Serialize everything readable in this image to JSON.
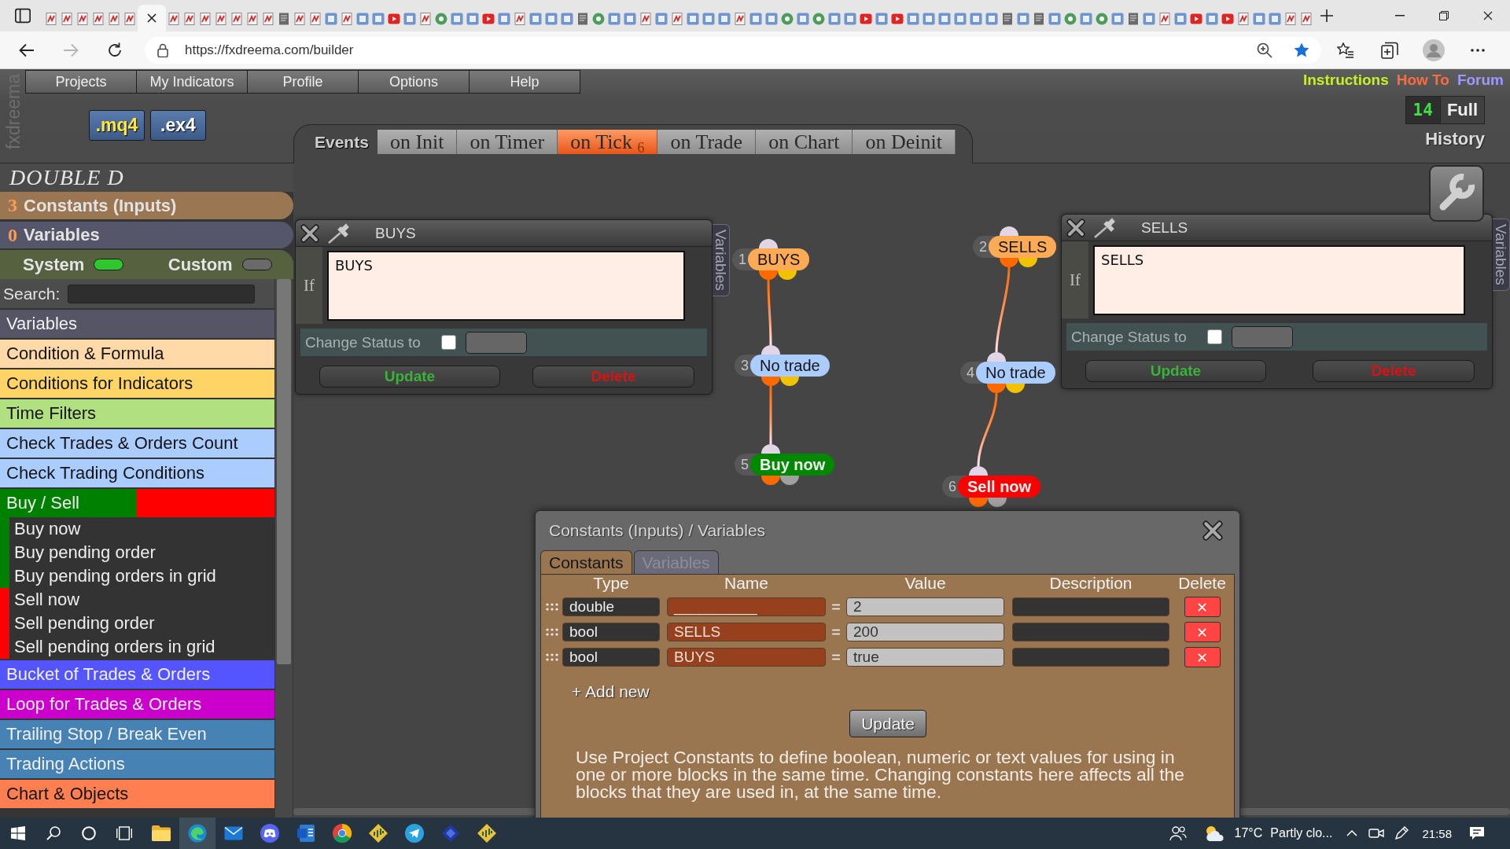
{
  "browser": {
    "tabs": [
      {
        "selected": false
      },
      {
        "selected": false
      },
      {
        "selected": false
      },
      {
        "selected": false
      },
      {
        "selected": false
      },
      {
        "selected": false
      },
      {
        "selected": true
      },
      {
        "selected": false
      },
      {
        "selected": false
      },
      {
        "selected": false
      },
      {
        "selected": false
      },
      {
        "selected": false
      },
      {
        "selected": false
      },
      {
        "selected": false
      },
      {
        "selected": false
      },
      {
        "selected": false
      },
      {
        "selected": false
      },
      {
        "selected": false
      },
      {
        "selected": false
      },
      {
        "selected": false
      },
      {
        "selected": false
      },
      {
        "selected": false
      },
      {
        "selected": false
      },
      {
        "selected": false
      },
      {
        "selected": false
      },
      {
        "selected": false
      },
      {
        "selected": false
      },
      {
        "selected": false
      },
      {
        "selected": false
      },
      {
        "selected": false
      },
      {
        "selected": false
      },
      {
        "selected": false
      },
      {
        "selected": false
      },
      {
        "selected": false
      },
      {
        "selected": false
      },
      {
        "selected": false
      },
      {
        "selected": false
      },
      {
        "selected": false
      },
      {
        "selected": false
      },
      {
        "selected": false
      },
      {
        "selected": false
      },
      {
        "selected": false
      },
      {
        "selected": false
      },
      {
        "selected": false
      },
      {
        "selected": false
      },
      {
        "selected": false
      },
      {
        "selected": false
      },
      {
        "selected": false
      },
      {
        "selected": false
      },
      {
        "selected": false
      },
      {
        "selected": false
      },
      {
        "selected": false
      },
      {
        "selected": false
      },
      {
        "selected": false
      },
      {
        "selected": false
      },
      {
        "selected": false
      },
      {
        "selected": false
      },
      {
        "selected": false
      },
      {
        "selected": false
      },
      {
        "selected": false
      },
      {
        "selected": false
      },
      {
        "selected": false
      },
      {
        "selected": false
      },
      {
        "selected": false
      },
      {
        "selected": false
      },
      {
        "selected": false
      },
      {
        "selected": false
      },
      {
        "selected": false
      },
      {
        "selected": false
      },
      {
        "selected": false
      },
      {
        "selected": false
      },
      {
        "selected": false
      },
      {
        "selected": false
      },
      {
        "selected": false
      },
      {
        "selected": false
      },
      {
        "selected": false
      },
      {
        "selected": false
      },
      {
        "selected": false
      },
      {
        "selected": false
      },
      {
        "selected": false
      }
    ],
    "url": "https://fxdreema.com/builder"
  },
  "header": {
    "logo": "fxdreema",
    "menu": [
      "Projects",
      "My Indicators",
      "Profile",
      "Options",
      "Help"
    ],
    "links": [
      {
        "label": "Instructions",
        "color": "#c6ef2a"
      },
      {
        "label": "How To",
        "color": "#ff6b3f"
      },
      {
        "label": "Forum",
        "color": "#9d98ff"
      }
    ],
    "exports": [
      {
        "label": ".mq4",
        "kind": "source"
      },
      {
        "label": ".ex4",
        "kind": "compiled"
      }
    ],
    "history": {
      "count": "14",
      "mode": "Full",
      "label": "History"
    }
  },
  "events": {
    "label": "Events",
    "tabs": [
      {
        "label": "on Init",
        "selected": false
      },
      {
        "label": "on Timer",
        "selected": false
      },
      {
        "label": "on Tick",
        "count": "6",
        "selected": true
      },
      {
        "label": "on Trade",
        "selected": false
      },
      {
        "label": "on Chart",
        "selected": false
      },
      {
        "label": "on Deinit",
        "selected": false
      }
    ]
  },
  "panel": {
    "project": "DOUBLE D",
    "constants": {
      "count": "3",
      "label": "Constants (Inputs)"
    },
    "variables": {
      "count": "0",
      "label": "Variables"
    },
    "toggles": [
      {
        "label": "System",
        "on": true
      },
      {
        "label": "Custom",
        "on": false
      }
    ],
    "search_label": "Search:",
    "categories": [
      {
        "label": "Variables",
        "color": "#555566"
      },
      {
        "label": "Condition & Formula",
        "color": "#ffd9a8"
      },
      {
        "label": "Conditions for Indicators",
        "color": "#ffd466"
      },
      {
        "label": "Time Filters",
        "color": "#b0e07f"
      },
      {
        "label": "Check Trades & Orders Count",
        "color": "#aaccff"
      },
      {
        "label": "Check Trading Conditions",
        "color": "#aaccff"
      },
      {
        "label": "Buy / Sell",
        "color": "#008000",
        "band": {
          "color": "#ff0000"
        },
        "children": [
          {
            "label": "Buy now",
            "color": "#008000"
          },
          {
            "label": "Buy pending order",
            "color": "#008000"
          },
          {
            "label": "Buy pending orders in grid",
            "color": "#008000"
          },
          {
            "label": "Sell now",
            "color": "#ff0000"
          },
          {
            "label": "Sell pending order",
            "color": "#ff0000"
          },
          {
            "label": "Sell pending orders in grid",
            "color": "#ff0000"
          }
        ]
      },
      {
        "label": "Bucket of Trades & Orders",
        "color": "#5555ff"
      },
      {
        "label": "Loop for Trades & Orders",
        "color": "#cc00cc"
      },
      {
        "label": "Trailing Stop / Break Even",
        "color": "#4682b4"
      },
      {
        "label": "Trading Actions",
        "color": "#4682b4"
      },
      {
        "label": "Chart & Objects",
        "color": "#ff7f50"
      }
    ]
  },
  "blocks": [
    {
      "title": "BUYS",
      "condition_label": "If",
      "expression": "BUYS",
      "status_label": "Change Status to",
      "status_checked": false,
      "buttons": [
        {
          "label": "Update",
          "kind": "update"
        },
        {
          "label": "Delete",
          "kind": "delete"
        }
      ],
      "side_tab": "Variables"
    },
    {
      "title": "SELLS",
      "condition_label": "If",
      "expression": "SELLS",
      "status_label": "Change Status to",
      "status_checked": false,
      "buttons": [
        {
          "label": "Update",
          "kind": "update"
        },
        {
          "label": "Delete",
          "kind": "delete"
        }
      ],
      "side_tab": "Variables"
    }
  ],
  "flows": [
    {
      "nodes": [
        {
          "number": "1",
          "label": "BUYS",
          "kind": "condition",
          "color": "#ffaa55"
        },
        {
          "number": "3",
          "label": "No trade",
          "kind": "condition",
          "color": "#aaccff"
        },
        {
          "number": "5",
          "label": "Buy now",
          "kind": "trade",
          "color": "#008800"
        }
      ]
    },
    {
      "nodes": [
        {
          "number": "2",
          "label": "SELLS",
          "kind": "condition",
          "color": "#ffaa55"
        },
        {
          "number": "4",
          "label": "No trade",
          "kind": "condition",
          "color": "#aaccff"
        },
        {
          "number": "6",
          "label": "Sell now",
          "kind": "trade",
          "color": "#ff0000"
        }
      ]
    }
  ],
  "dialog": {
    "title": "Constants (Inputs) / Variables",
    "tabs": [
      {
        "label": "Constants",
        "selected": true
      },
      {
        "label": "Variables",
        "selected": false
      }
    ],
    "columns": [
      "Type",
      "Name",
      "Value",
      "Description",
      "Delete"
    ],
    "rows": [
      {
        "type": "double",
        "name": "__________",
        "operator": "=",
        "value": "2"
      },
      {
        "type": "bool",
        "name": "SELLS",
        "operator": "=",
        "value": "200"
      },
      {
        "type": "bool",
        "name": "BUYS",
        "operator": "=",
        "value": "true"
      }
    ],
    "add_label": "+ Add new",
    "update_label": "Update",
    "help": "Use Project Constants to define boolean, numeric or text values for using in one or more blocks in the same time. Changing constants here affects all the blocks that they are used in, at the same time."
  },
  "taskbar": {
    "apps": [
      {
        "selected": false
      },
      {
        "selected": true
      },
      {
        "selected": false
      },
      {
        "selected": false
      },
      {
        "selected": false
      },
      {
        "selected": false
      },
      {
        "selected": false
      },
      {
        "selected": false
      },
      {
        "selected": false
      },
      {
        "selected": false
      }
    ],
    "temperature": "17°C",
    "weather": "Partly clo...",
    "clock": "21:58"
  }
}
